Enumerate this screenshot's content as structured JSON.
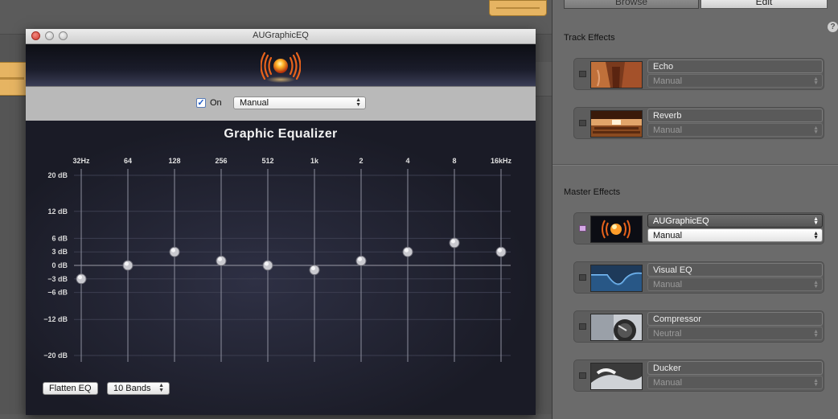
{
  "window": {
    "title": "AUGraphicEQ",
    "on_label": "On",
    "on_checked": true,
    "preset": "Manual"
  },
  "equalizer": {
    "title": "Graphic Equalizer",
    "bands": [
      "32Hz",
      "64",
      "128",
      "256",
      "512",
      "1k",
      "2",
      "4",
      "8",
      "16kHz"
    ],
    "gains_db": [
      -3,
      0,
      3,
      1,
      0,
      -1,
      1,
      3,
      5,
      3
    ],
    "db_labels": [
      "20 dB",
      "12 dB",
      "6 dB",
      "3 dB",
      "0 dB",
      "−3 dB",
      "−6 dB",
      "−12 dB",
      "−20 dB"
    ],
    "db_values": [
      20,
      12,
      6,
      3,
      0,
      -3,
      -6,
      -12,
      -20
    ],
    "flatten_label": "Flatten EQ",
    "bands_select": "10 Bands"
  },
  "panel": {
    "tabs": {
      "browse": "Browse",
      "edit": "Edit"
    },
    "help_icon": "?",
    "track_effects_label": "Track Effects",
    "master_effects_label": "Master Effects",
    "track_effects": [
      {
        "name": "Echo",
        "preset": "Manual"
      },
      {
        "name": "Reverb",
        "preset": "Manual"
      }
    ],
    "master_effects": [
      {
        "name": "AUGraphicEQ",
        "preset": "Manual",
        "enabled": true
      },
      {
        "name": "Visual EQ",
        "preset": "Manual"
      },
      {
        "name": "Compressor",
        "preset": "Neutral"
      },
      {
        "name": "Ducker",
        "preset": "Manual"
      }
    ]
  },
  "colors": {
    "led_on": "#d5a8e6",
    "eq_bg": "#1e1f2b",
    "accent_orange": "#e6b462"
  }
}
